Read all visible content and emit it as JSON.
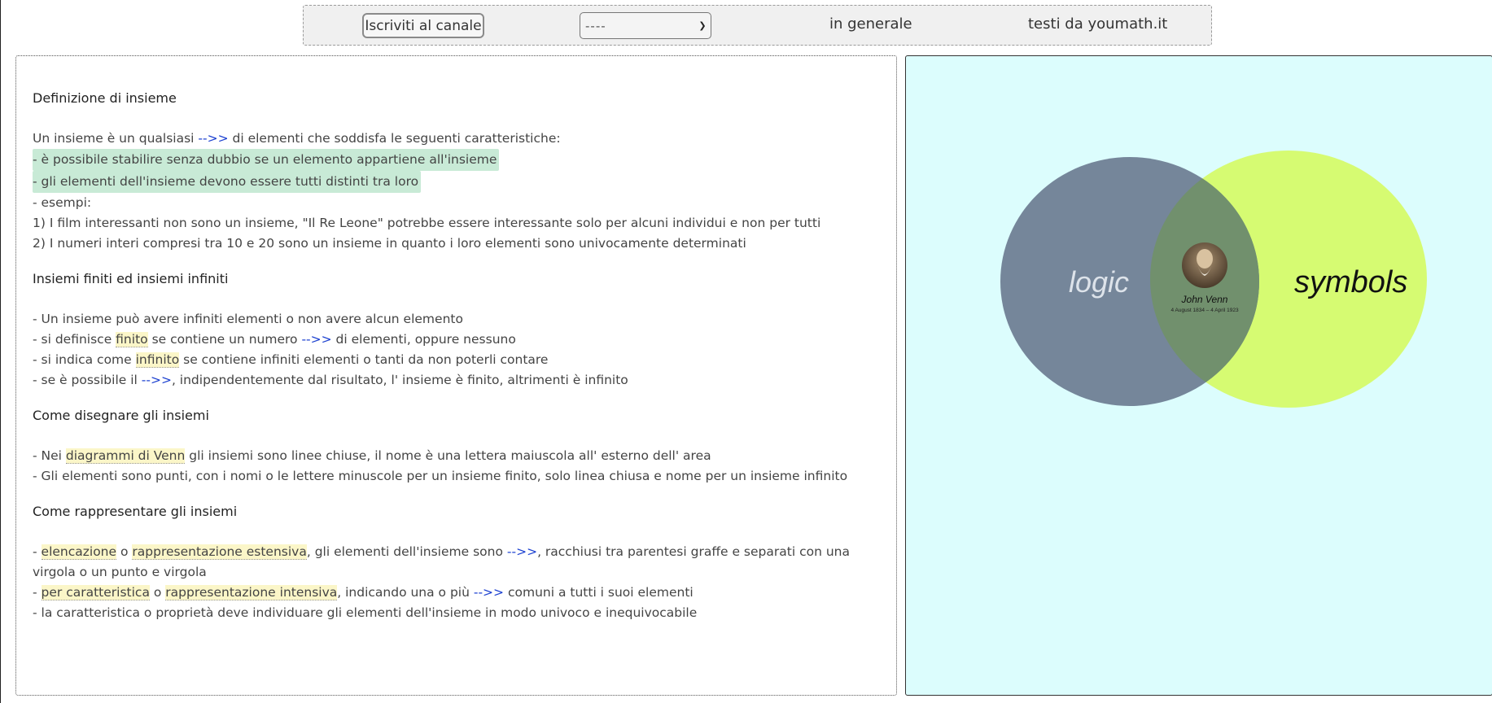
{
  "toolbar": {
    "subscribe_label": "Iscriviti al canale",
    "select_value": "----",
    "link_general": "in generale",
    "link_texts": "testi da youmath.it"
  },
  "content": {
    "s1_title": "Definizione di insieme",
    "s1_l1_a": "Un insieme è un qualsiasi ",
    "arrow": "-->>",
    "s1_l1_b": " di elementi che soddisfa le seguenti caratteristiche:",
    "s1_l2": "- è possibile stabilire senza dubbio se un elemento appartiene all'insieme",
    "s1_l3": "- gli elementi dell'insieme devono essere tutti distinti tra loro",
    "s1_l4": "- esempi:",
    "s1_l5": "1) I film interessanti non sono un insieme, \"Il Re Leone\" potrebbe essere interessante solo per alcuni individui e non per tutti",
    "s1_l6": "2) I numeri interi compresi tra 10 e 20 sono un insieme in quanto i loro elementi sono univocamente determinati",
    "s2_title": "Insiemi finiti ed insiemi infiniti",
    "s2_l1": "- Un insieme può avere infiniti elementi o non avere alcun elemento",
    "s2_l2_a": "- si definisce ",
    "s2_l2_term": "finito",
    "s2_l2_b": " se contiene un numero ",
    "s2_l2_c": " di elementi, oppure nessuno",
    "s2_l3_a": "- si indica come ",
    "s2_l3_term": "infinito",
    "s2_l3_b": " se contiene infiniti elementi o tanti da non poterli contare",
    "s2_l4_a": "- se è possibile il ",
    "s2_l4_b": ", indipendentemente dal risultato, l' insieme è finito, altrimenti è infinito",
    "s3_title": "Come disegnare gli insiemi",
    "s3_l1_a": "- Nei ",
    "s3_l1_term": "diagrammi di Venn",
    "s3_l1_b": " gli insiemi sono linee chiuse, il nome è una lettera maiuscola all' esterno dell' area",
    "s3_l2": "- Gli elementi sono punti, con i nomi o le lettere minuscole per un insieme finito, solo linea chiusa e nome per un insieme infinito",
    "s4_title": "Come rappresentare gli insiemi",
    "s4_l1_a": "- ",
    "s4_l1_term1": "elencazione",
    "s4_l1_o": " o ",
    "s4_l1_term2": "rappresentazione estensiva",
    "s4_l1_b": ", gli elementi dell'insieme sono ",
    "s4_l1_c": ", racchiusi tra parentesi graffe e separati con una virgola o un punto e virgola",
    "s4_l2_a": "- ",
    "s4_l2_term1": "per caratteristica",
    "s4_l2_o": " o ",
    "s4_l2_term2": "rappresentazione intensiva",
    "s4_l2_b": ", indicando una o più ",
    "s4_l2_c": " comuni a tutti i suoi elementi",
    "s4_l3": "- la caratteristica o proprietà deve individuare gli elementi dell'insieme in modo univoco e inequivocabile"
  },
  "venn": {
    "left_label": "logic",
    "right_label": "symbols",
    "person_name": "John Venn",
    "person_dates": "4 August 1834 – 4 April 1923",
    "colors": {
      "left": "#75869a",
      "right": "#d6fb72",
      "overlap": "#71906d",
      "panel_bg": "#dcfdfd"
    }
  }
}
